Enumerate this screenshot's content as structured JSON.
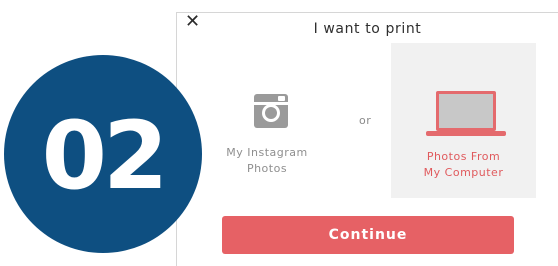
{
  "step_badge": "02",
  "dialog": {
    "close_glyph": "✕",
    "title": "I want to print",
    "options": [
      {
        "label_line1": "My Instagram",
        "label_line2": "Photos",
        "icon": "instagram-icon"
      },
      {
        "label_line1": "Photos From",
        "label_line2": "My Computer",
        "icon": "laptop-icon"
      }
    ],
    "separator": "or",
    "continue_label": "Continue"
  },
  "colors": {
    "badge": "#0e4f81",
    "accent": "#e66165",
    "selected_bg": "#f1f1f1"
  }
}
